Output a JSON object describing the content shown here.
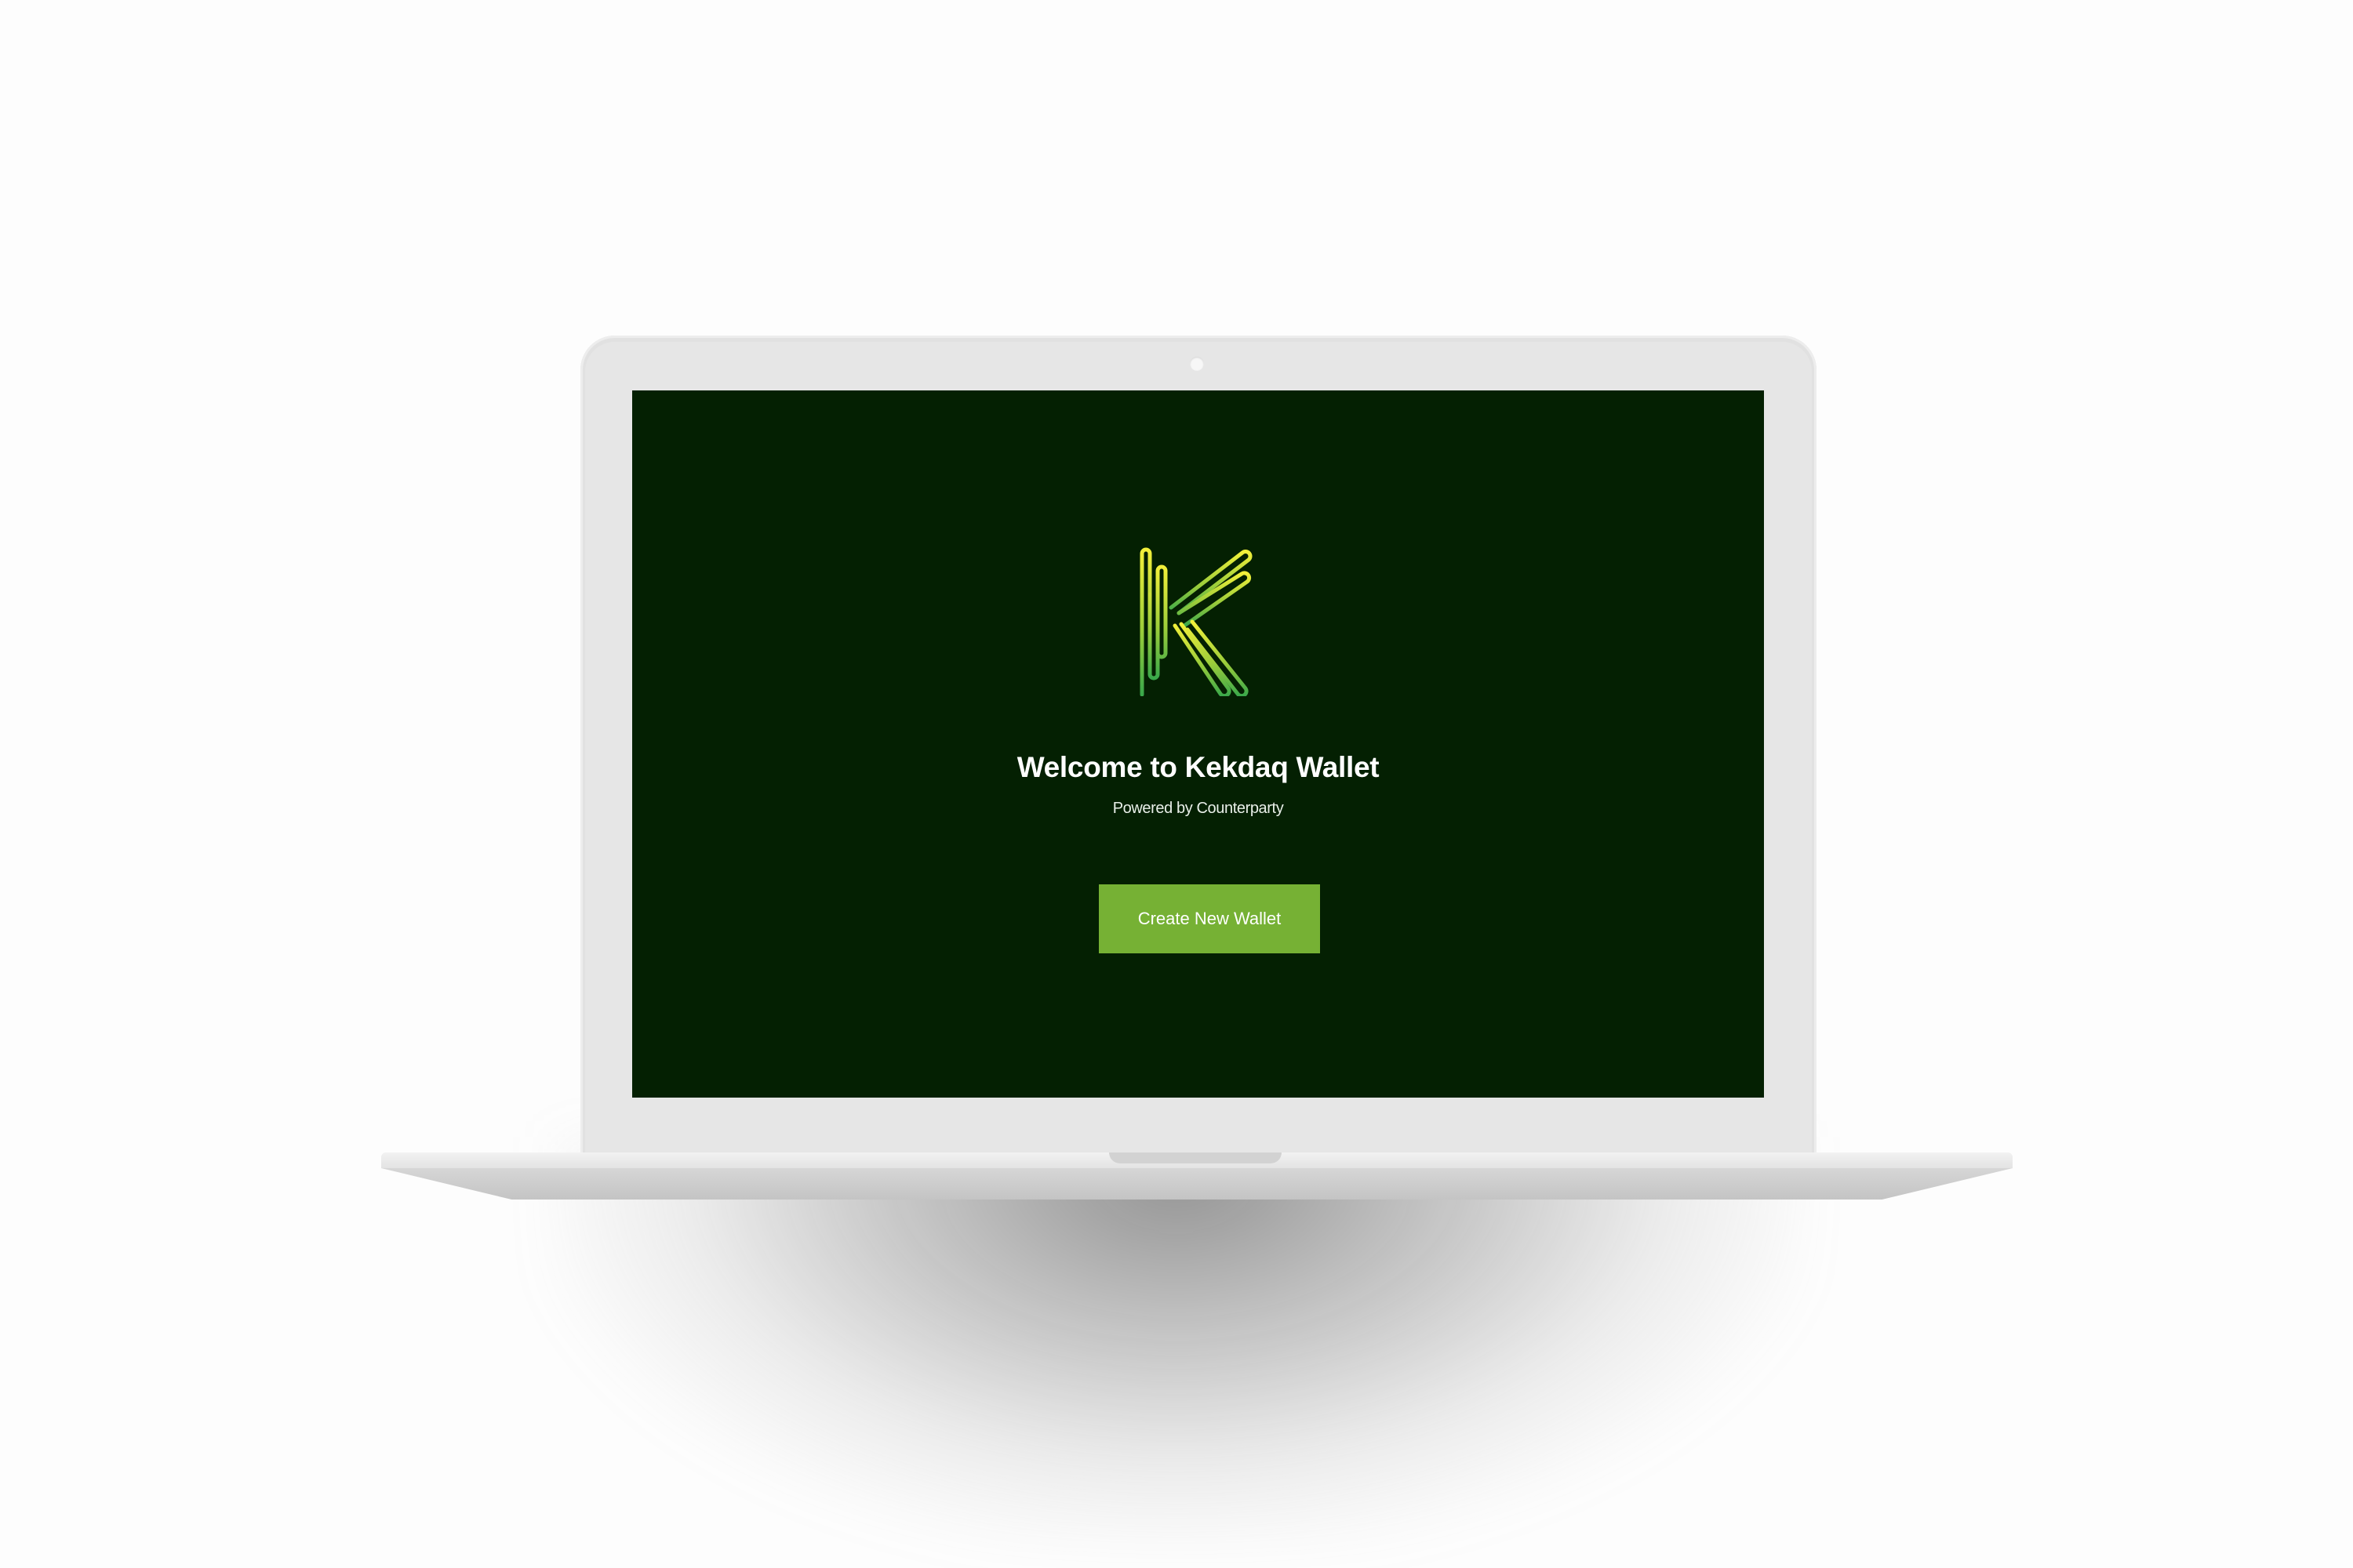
{
  "welcome": {
    "title": "Welcome to Kekdaq Wallet",
    "subtitle": "Powered by Counterparty",
    "create_button_label": "Create New Wallet"
  },
  "icons": {
    "logo": "kekdaq-k-logo-icon",
    "camera": "camera-dot"
  },
  "colors": {
    "screen_background": "#042002",
    "button": "#76b134",
    "logo_gradient_top": "#f2f03a",
    "logo_gradient_bottom": "#3aa84a",
    "title_text": "#ffffff"
  }
}
